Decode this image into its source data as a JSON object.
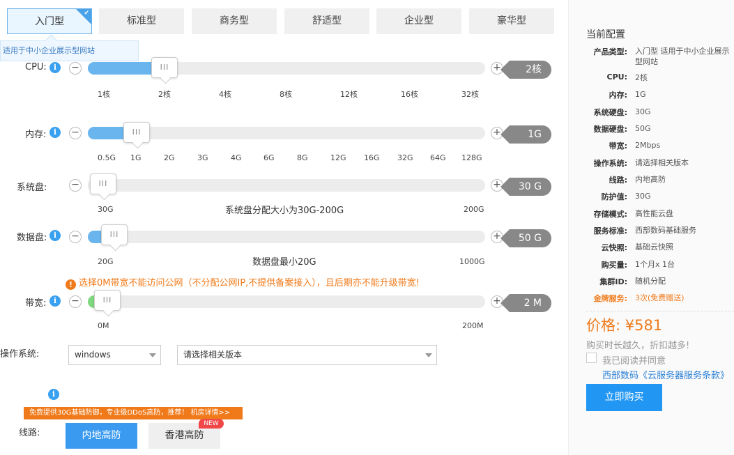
{
  "tabs": [
    {
      "label": "入门型",
      "active": true
    },
    {
      "label": "标准型"
    },
    {
      "label": "商务型"
    },
    {
      "label": "舒适型"
    },
    {
      "label": "企业型"
    },
    {
      "label": "豪华型"
    }
  ],
  "tab_tooltip": "适用于中小企业展示型网站",
  "cpu": {
    "label": "CPU:",
    "value": "2核",
    "ticks": [
      "1核",
      "2核",
      "4核",
      "8核",
      "12核",
      "16核",
      "32核"
    ],
    "handle": "III"
  },
  "memory": {
    "label": "内存:",
    "value": "1G",
    "ticks": [
      "0.5G",
      "1G",
      "2G",
      "3G",
      "4G",
      "6G",
      "8G",
      "12G",
      "16G",
      "32G",
      "64G",
      "128G"
    ],
    "handle": "III"
  },
  "system_disk": {
    "label": "系统盘:",
    "value": "30 G",
    "min": "30G",
    "max": "200G",
    "note": "系统盘分配大小为30G-200G",
    "handle": "III"
  },
  "data_disk": {
    "label": "数据盘:",
    "value": "50 G",
    "min": "20G",
    "max": "1000G",
    "note": "数据盘最小20G",
    "handle": "III"
  },
  "bandwidth_warning": "选择0M带宽不能访问公网（不分配公网IP,不提供备案接入），且后期亦不能升级带宽!",
  "bandwidth": {
    "label": "带宽:",
    "value": "2 M",
    "min": "0M",
    "max": "200M",
    "handle": "III"
  },
  "os": {
    "label": "操作系统:",
    "selected": "windows",
    "version_placeholder": "请选择相关版本"
  },
  "line": {
    "label": "线路:",
    "promo": "免费提供30G基础防御，专业级DDoS高防，推荐！ 机房详情>>",
    "options": [
      "内地高防",
      "香港高防"
    ],
    "new_badge": "NEW"
  },
  "icons": {
    "info": "i",
    "minus": "−",
    "plus": "+",
    "warn": "!"
  },
  "colors": {
    "accent": "#2196f3",
    "orange": "#f07a1a",
    "tag_gray": "#888888"
  },
  "summary": {
    "title": "当前配置",
    "rows": [
      {
        "key": "产品类型:",
        "value": "入门型 适用于中小企业展示型网站"
      },
      {
        "key": "CPU:",
        "value": "2核"
      },
      {
        "key": "内存:",
        "value": "1G"
      },
      {
        "key": "系统硬盘:",
        "value": "30G"
      },
      {
        "key": "数据硬盘:",
        "value": "50G"
      },
      {
        "key": "带宽:",
        "value": "2Mbps"
      },
      {
        "key": "操作系统:",
        "value": "请选择相关版本"
      },
      {
        "key": "线路:",
        "value": "内地高防"
      },
      {
        "key": "防护值:",
        "value": "30G"
      },
      {
        "key": "存储模式:",
        "value": "高性能云盘"
      },
      {
        "key": "服务标准:",
        "value": "西部数码基础服务"
      },
      {
        "key": "云快照:",
        "value": "基础云快照"
      },
      {
        "key": "购买量:",
        "value": "1个月x 1台"
      },
      {
        "key": "集群ID:",
        "value": "随机分配"
      },
      {
        "key": "金牌服务:",
        "value": "3次(免费赠送)"
      }
    ],
    "price": "价格: ¥581",
    "slogan": "购买时长越久，折扣越多!",
    "agree": "我已阅读并同意",
    "terms": "西部数码《云服务器服务条款》",
    "buy": "立即购买"
  }
}
